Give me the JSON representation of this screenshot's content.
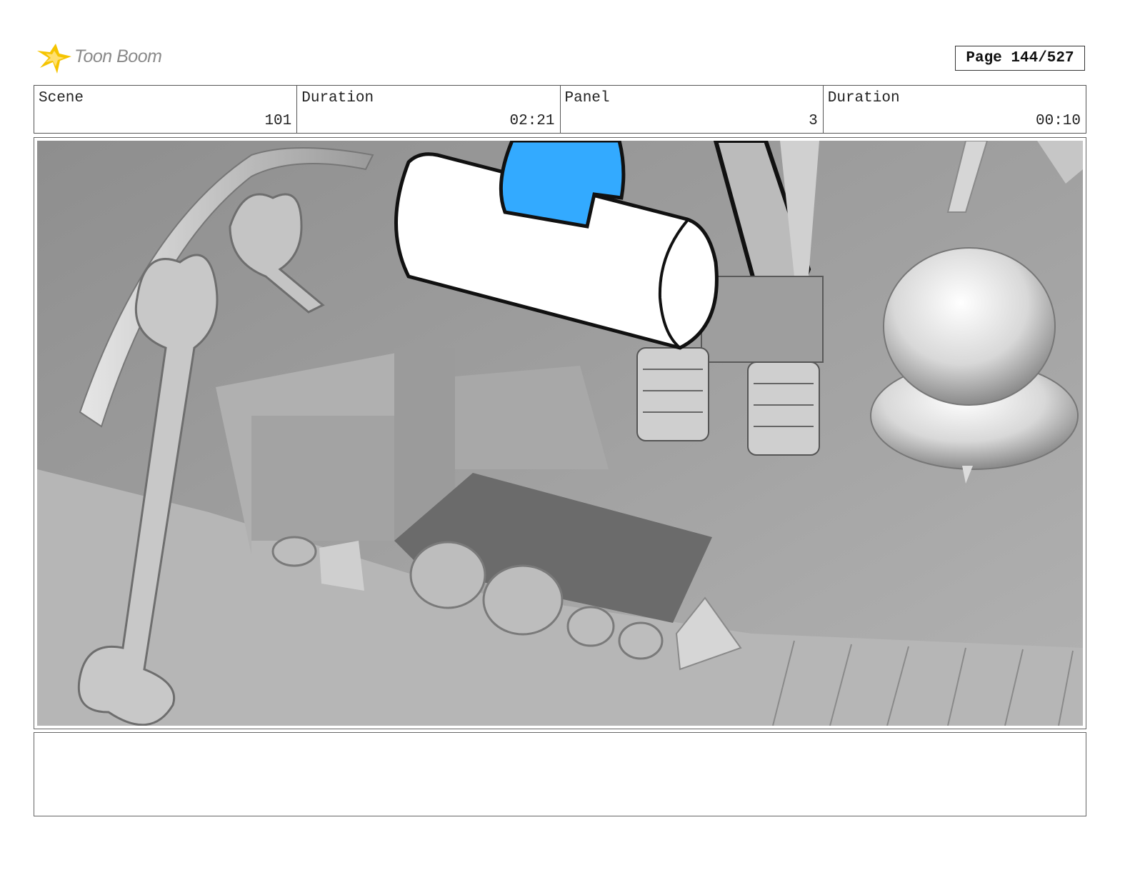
{
  "header": {
    "logo_text": "Toon Boom",
    "page_label": "Page 144/527"
  },
  "info": {
    "scene_label": "Scene",
    "scene_value": "101",
    "scene_duration_label": "Duration",
    "scene_duration_value": "02:21",
    "panel_label": "Panel",
    "panel_value": "3",
    "panel_duration_label": "Duration",
    "panel_duration_value": "00:10"
  },
  "colors": {
    "accent_blue": "#33aaff",
    "logo_yellow": "#f5c400"
  },
  "notes": {
    "text": ""
  }
}
